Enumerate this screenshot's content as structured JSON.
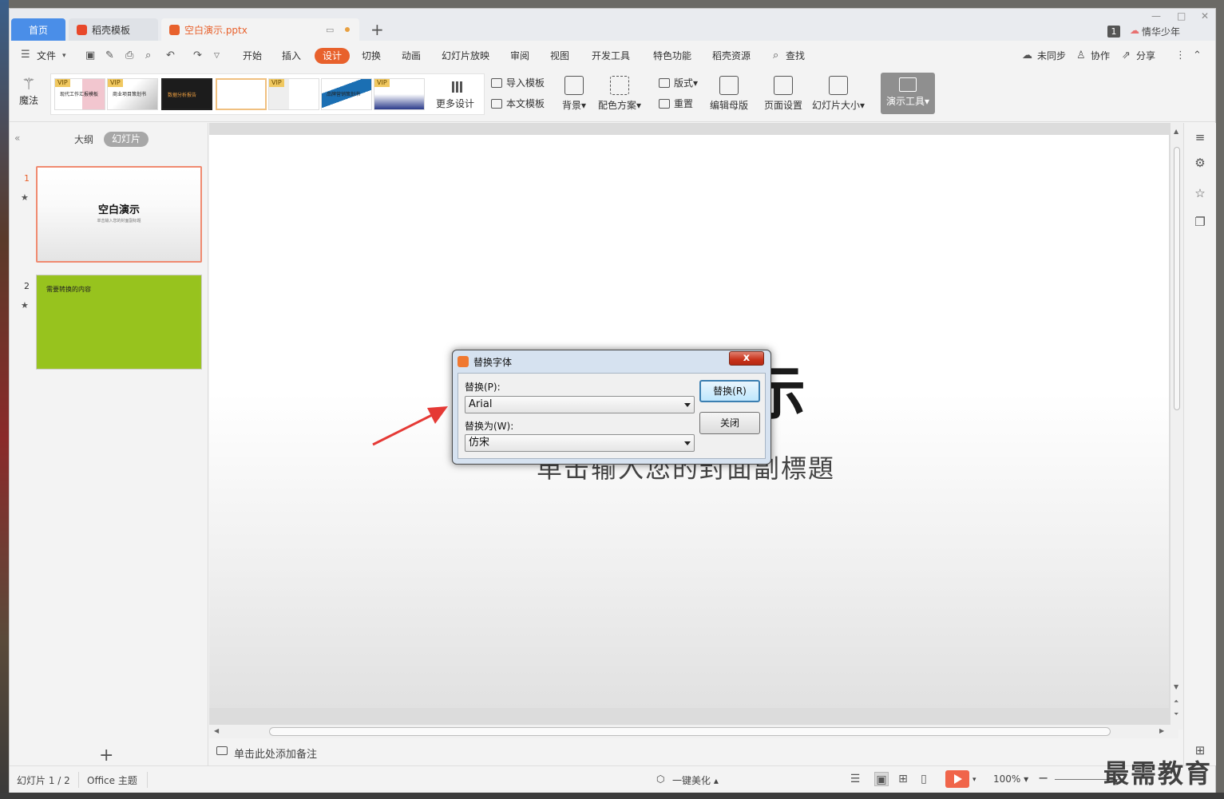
{
  "tabs": {
    "home": "首页",
    "template": "稻壳模板",
    "file": "空白演示.pptx",
    "user_badge": "1",
    "user_name": "情华少年"
  },
  "menu": {
    "file": "文件",
    "items": [
      "开始",
      "插入",
      "设计",
      "切换",
      "动画",
      "幻灯片放映",
      "审阅",
      "视图",
      "开发工具",
      "特色功能",
      "稻壳资源"
    ],
    "active": "设计",
    "search": "查找",
    "sync": "未同步",
    "collab": "协作",
    "share": "分享"
  },
  "ribbon": {
    "magic": "魔法",
    "more_design": "更多设计",
    "import_template": "导入模板",
    "this_template": "本文模板",
    "background": "背景",
    "color_scheme": "配色方案",
    "layout": "版式",
    "reset": "重置",
    "edit_master": "编辑母版",
    "page_setup": "页面设置",
    "slide_size": "幻灯片大小",
    "present_tools": "演示工具",
    "vip": "VIP",
    "thumb_texts": [
      "现代工作汇报模板",
      "商业项目策划书",
      "数据分析报告",
      "",
      "",
      "品牌营销策划书",
      ""
    ]
  },
  "left_panel": {
    "outline": "大纲",
    "slides": "幻灯片",
    "slide1_num": "1",
    "slide1_title": "空白演示",
    "slide1_sub": "单击输入您的封面副标题",
    "slide2_num": "2",
    "slide2_text": "需要转换的内容"
  },
  "slide": {
    "title": "空白演示",
    "subtitle": "单击输入您的封面副標題"
  },
  "notes": {
    "placeholder": "单击此处添加备注"
  },
  "status": {
    "slide_counter": "幻灯片 1 / 2",
    "theme": "Office 主题",
    "beautify": "一键美化",
    "zoom": "100%"
  },
  "dialog": {
    "title": "替换字体",
    "replace_label": "替换(P):",
    "replace_value": "Arial",
    "with_label": "替换为(W):",
    "with_value": "仿宋",
    "replace_button": "替换(R)",
    "close_button": "关闭",
    "close_x": "x"
  },
  "watermark": "最需教育",
  "colors": {
    "accent": "#e8612c",
    "tab_active": "#4a8ee8",
    "slide2_bg": "#97c31e",
    "arrow": "#e53935"
  }
}
